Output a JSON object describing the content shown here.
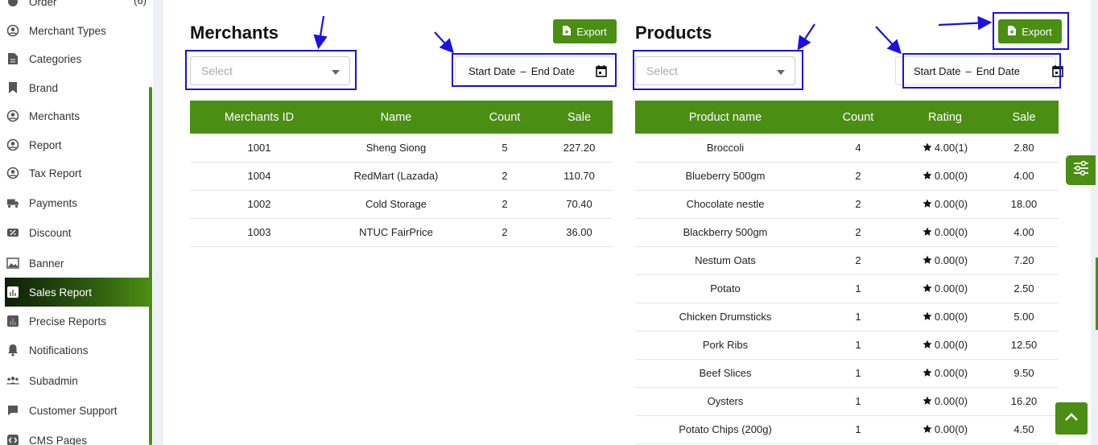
{
  "sidebar": {
    "order_label": "Order",
    "order_count": "(6)",
    "items": [
      {
        "label": "Merchant Types",
        "icon": "user-circle-icon"
      },
      {
        "label": "Categories",
        "icon": "document-icon"
      },
      {
        "label": "Brand",
        "icon": "bookmark-icon"
      },
      {
        "label": "Merchants",
        "icon": "user-circle-icon"
      },
      {
        "label": "Report",
        "icon": "user-circle-icon"
      },
      {
        "label": "Tax Report",
        "icon": "user-circle-icon"
      },
      {
        "label": "Payments",
        "icon": "truck-icon"
      },
      {
        "label": "Discount",
        "icon": "discount-icon"
      },
      {
        "label": "Banner",
        "icon": "image-icon"
      },
      {
        "label": "Sales Report",
        "icon": "chart-icon",
        "active": true
      },
      {
        "label": "Precise Reports",
        "icon": "chart-icon"
      },
      {
        "label": "Notifications",
        "icon": "bell-icon"
      },
      {
        "label": "Subadmin",
        "icon": "users-icon"
      },
      {
        "label": "Customer Support",
        "icon": "chat-icon"
      },
      {
        "label": "CMS Pages",
        "icon": "code-icon"
      }
    ]
  },
  "merchants": {
    "title": "Merchants",
    "export_label": "Export",
    "select_placeholder": "Select",
    "start_date": "Start Date",
    "date_separator": "–",
    "end_date": "End Date",
    "columns": [
      "Merchants ID",
      "Name",
      "Count",
      "Sale"
    ],
    "rows": [
      [
        "1001",
        "Sheng Siong",
        "5",
        "227.20"
      ],
      [
        "1004",
        "RedMart (Lazada)",
        "2",
        "110.70"
      ],
      [
        "1002",
        "Cold Storage",
        "2",
        "70.40"
      ],
      [
        "1003",
        "NTUC FairPrice",
        "2",
        "36.00"
      ]
    ]
  },
  "products": {
    "title": "Products",
    "export_label": "Export",
    "select_placeholder": "Select",
    "start_date": "Start Date",
    "date_separator": "–",
    "end_date": "End Date",
    "columns": [
      "Product name",
      "Count",
      "Rating",
      "Sale"
    ],
    "rows": [
      [
        "Broccoli",
        "4",
        "4.00(1)",
        "2.80"
      ],
      [
        "Blueberry 500gm",
        "2",
        "0.00(0)",
        "4.00"
      ],
      [
        "Chocolate nestle",
        "2",
        "0.00(0)",
        "18.00"
      ],
      [
        "Blackberry 500gm",
        "2",
        "0.00(0)",
        "4.00"
      ],
      [
        "Nestum Oats",
        "2",
        "0.00(0)",
        "7.20"
      ],
      [
        "Potato",
        "1",
        "0.00(0)",
        "2.50"
      ],
      [
        "Chicken Drumsticks",
        "1",
        "0.00(0)",
        "5.00"
      ],
      [
        "Pork Ribs",
        "1",
        "0.00(0)",
        "12.50"
      ],
      [
        "Beef Slices",
        "1",
        "0.00(0)",
        "9.50"
      ],
      [
        "Oysters",
        "1",
        "0.00(0)",
        "16.20"
      ],
      [
        "Potato Chips (200g)",
        "1",
        "0.00(0)",
        "4.50"
      ]
    ]
  },
  "colors": {
    "accent": "#4a8e14",
    "highlight": "#1a12e0"
  }
}
